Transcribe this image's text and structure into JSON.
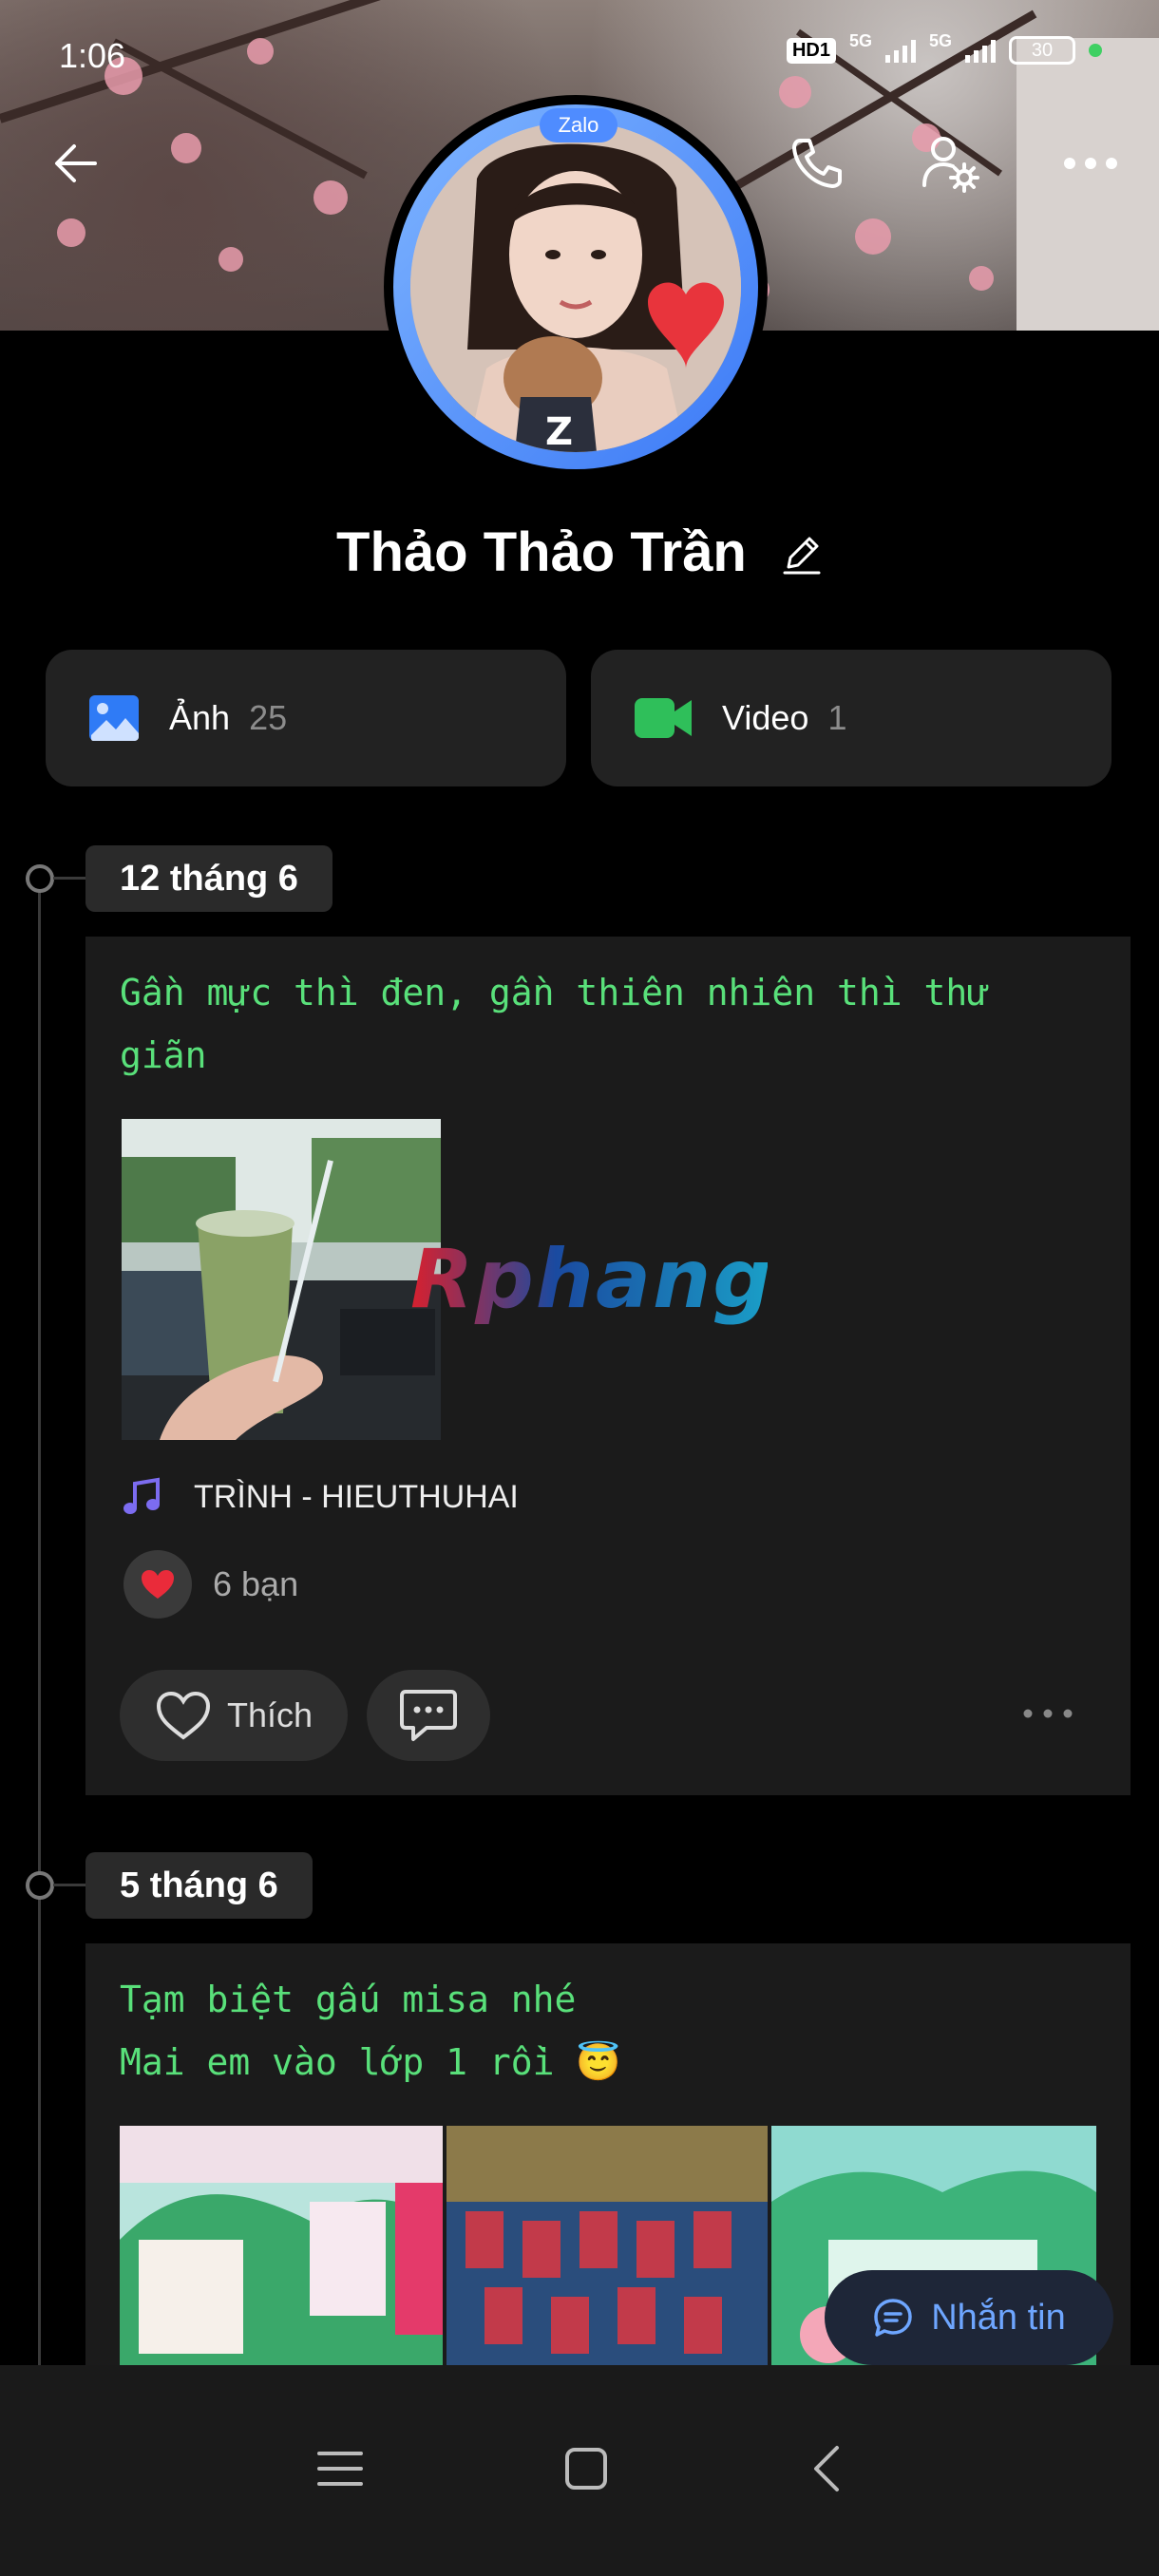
{
  "status_bar": {
    "time": "1:06",
    "hd": "HD1",
    "net1": "5G",
    "net2": "5G",
    "battery": "30"
  },
  "header": {
    "back_icon": "arrow-left-icon",
    "call_icon": "phone-icon",
    "settings_icon": "user-settings-icon",
    "more_icon": "more-horizontal-icon"
  },
  "profile": {
    "badge": "Zalo",
    "name": "Thảo Thảo Trần"
  },
  "media_tiles": [
    {
      "label": "Ảnh",
      "count": "25",
      "icon": "image-icon",
      "color": "#2f7bf6"
    },
    {
      "label": "Video",
      "count": "1",
      "icon": "video-icon",
      "color": "#2fbf5a"
    }
  ],
  "posts": [
    {
      "date": "12 tháng 6",
      "text_line1": "Gần mực thì đen, gần thiên nhiên thì thư",
      "text_line2": "giãn",
      "song": "TRÌNH - HIEUTHUHAI",
      "reactions": "6 bạn",
      "like_label": "Thích"
    },
    {
      "date": "5 tháng 6",
      "text_line1": "Tạm biệt gấu misa nhé",
      "text_line2": "Mai em vào lớp 1 rồi 😇"
    }
  ],
  "watermark": "Rphang",
  "message_button": "Nhắn tin",
  "colors": {
    "accent_green": "#59e07a",
    "accent_blue": "#6ea6ff",
    "card_bg": "#1b1b1b"
  }
}
